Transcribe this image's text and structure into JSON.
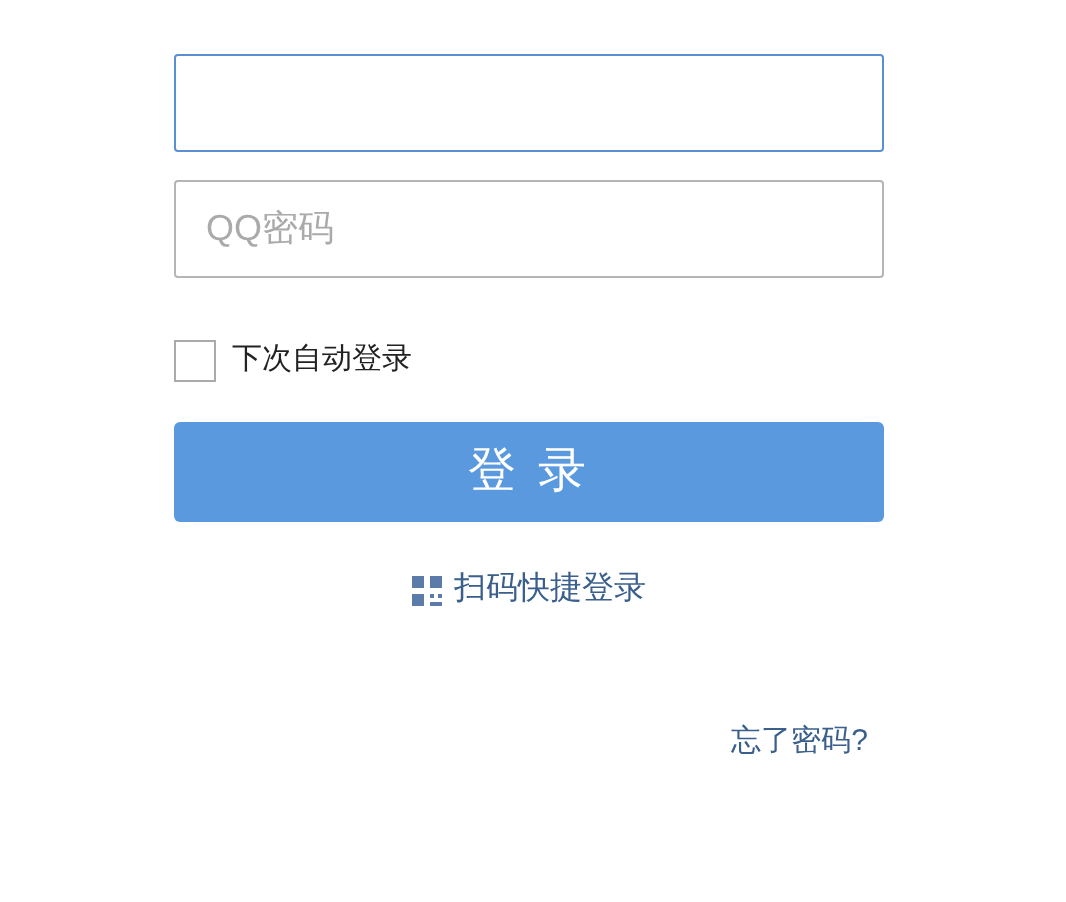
{
  "fields": [
    {
      "focused": true
    },
    {
      "placeholder": "QQ密码",
      "focused": false
    }
  ],
  "remember": {
    "label": "下次自动登录",
    "checked": false
  },
  "login_button": "登 录",
  "qr_login": "扫码快捷登录",
  "forgot_password": "忘了密码?"
}
